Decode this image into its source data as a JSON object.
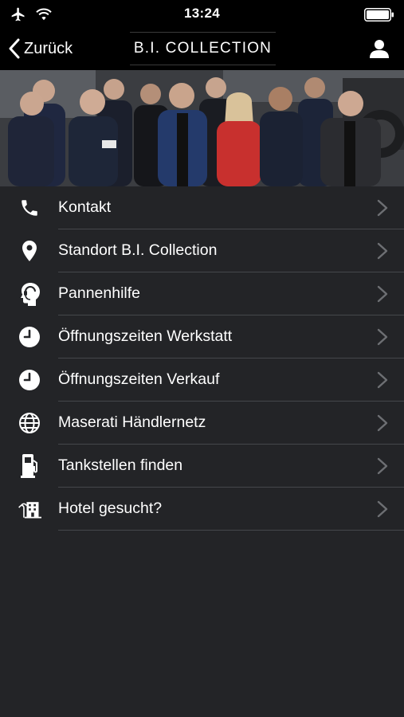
{
  "status_bar": {
    "time": "13:24",
    "icons": [
      "airplane-icon",
      "wifi-icon",
      "battery-icon"
    ]
  },
  "nav": {
    "back_label": "Zurück",
    "title": "B.I. COLLECTION",
    "back_icon": "chevron-left-icon",
    "user_icon": "user-icon"
  },
  "hero": {
    "description_icon": "team-photo"
  },
  "menu": {
    "items": [
      {
        "label": "Kontakt",
        "icon": "phone-icon"
      },
      {
        "label": "Standort B.I. Collection",
        "icon": "location-pin-icon"
      },
      {
        "label": "Pannenhilfe",
        "icon": "headset-icon"
      },
      {
        "label": "Öffnungszeiten Werkstatt",
        "icon": "clock-icon"
      },
      {
        "label": "Öffnungszeiten Verkauf",
        "icon": "clock-icon"
      },
      {
        "label": "Maserati Händlernetz",
        "icon": "globe-icon"
      },
      {
        "label": "Tankstellen finden",
        "icon": "fuel-pump-icon"
      },
      {
        "label": "Hotel gesucht?",
        "icon": "hotel-icon"
      }
    ]
  },
  "colors": {
    "background": "#232427",
    "bar": "#000000",
    "divider": "#45474b",
    "chevron": "#6d6f73"
  }
}
